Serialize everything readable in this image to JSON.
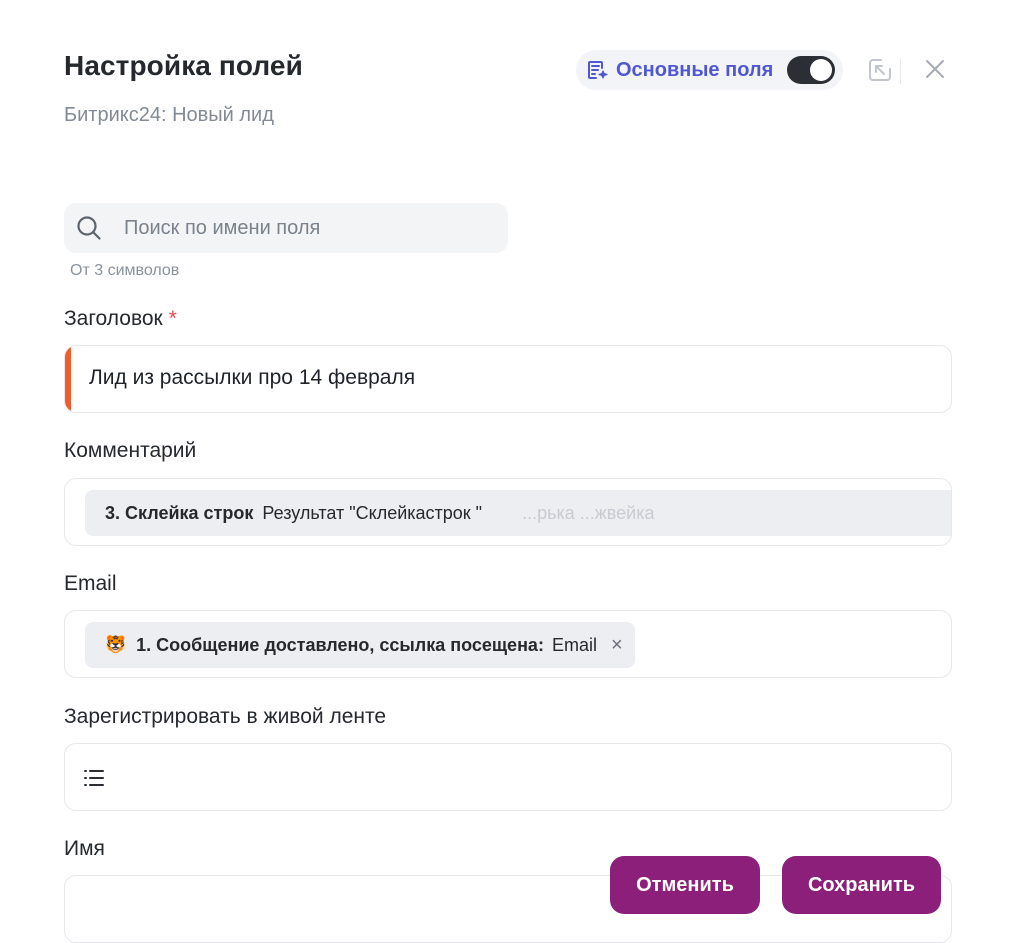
{
  "header": {
    "title": "Настройка полей",
    "subtitle": "Битрикс24: Новый лид",
    "mode_label": "Основные поля",
    "mode_enabled": true
  },
  "search": {
    "placeholder": "Поиск по имени поля",
    "value": "",
    "hint": "От 3 символов"
  },
  "fields": {
    "title": {
      "label": "Заголовок",
      "required_mark": "*",
      "value": "Лид из рассылки про 14 февраля"
    },
    "comment": {
      "label": "Комментарий",
      "chip_title": "3. Склейка строк",
      "chip_value": "Результат \"Склейкастрок \"",
      "chip_faded": "...рька   ...жвейка"
    },
    "email": {
      "label": "Email",
      "chip_emoji": "🐯",
      "chip_title": "1. Сообщение доставлено, ссылка посещена:",
      "chip_value": "Email",
      "chip_remove": "×"
    },
    "feed": {
      "label": "Зарегистрировать в живой ленте"
    },
    "name": {
      "label": "Имя",
      "value": ""
    }
  },
  "footer": {
    "cancel_label": "Отменить",
    "save_label": "Сохранить"
  },
  "colors": {
    "accent": "#5058d1",
    "button": "#8b1f7a",
    "required": "#e5484d",
    "field_marker": "#f25c2a"
  },
  "icons": [
    "ai-fields-icon",
    "collapse-icon",
    "close-icon",
    "search-icon",
    "list-icon"
  ]
}
